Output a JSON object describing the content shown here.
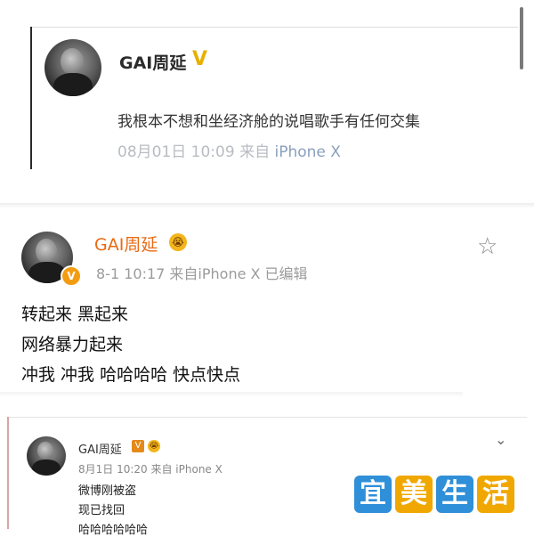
{
  "post1": {
    "author": "GAI周延",
    "verified_mark": "V",
    "text": "我根本不想和坐经济舱的说唱歌手有任何交集",
    "date_time": "08月01日 10:09",
    "source_prefix": "来自",
    "source_device": "iPhone X"
  },
  "post2": {
    "author": "GAI周延",
    "verified_mark": "V",
    "emoji_badge": "😭",
    "star_icon": "☆",
    "meta": "8-1 10:17  来自iPhone X  已编辑",
    "lines": [
      "转起来 黑起来",
      "网络暴力起来",
      "冲我 冲我 哈哈哈哈 快点快点"
    ]
  },
  "post3": {
    "author": "GAI周延",
    "verified_mark": "V",
    "emoji_badge": "😭",
    "chevron": "⌄",
    "meta": "8月1日 10:20 来自 iPhone X",
    "lines": [
      "微博刚被盗",
      "现已找回",
      "哈哈哈哈哈哈"
    ]
  },
  "watermark": {
    "chars": [
      "宜",
      "美",
      "生",
      "活"
    ]
  },
  "colors": {
    "accent_orange": "#e86a13",
    "verified_gold": "#e7b000",
    "watermark_blue": "#2f8fd8",
    "watermark_yellow": "#f0a800"
  }
}
